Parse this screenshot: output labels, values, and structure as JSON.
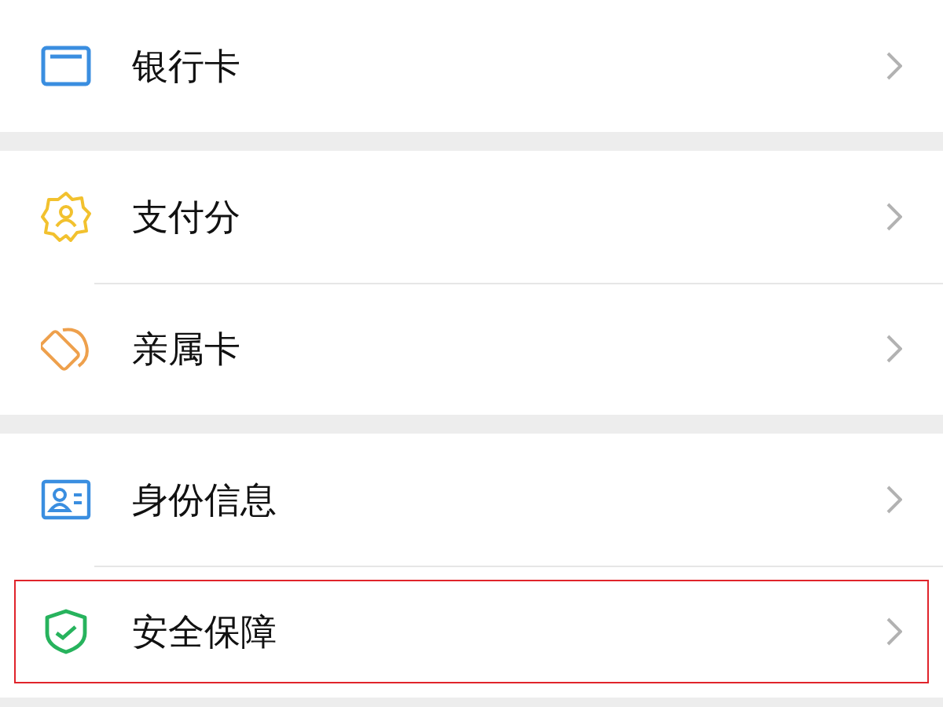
{
  "sections": [
    {
      "items": [
        {
          "kind": "card",
          "label": "银行卡",
          "highlighted": false
        }
      ]
    },
    {
      "items": [
        {
          "kind": "score",
          "label": "支付分",
          "highlighted": false
        },
        {
          "kind": "family",
          "label": "亲属卡",
          "highlighted": false
        }
      ]
    },
    {
      "items": [
        {
          "kind": "id",
          "label": "身份信息",
          "highlighted": false
        },
        {
          "kind": "shield",
          "label": "安全保障",
          "highlighted": true
        }
      ]
    }
  ]
}
